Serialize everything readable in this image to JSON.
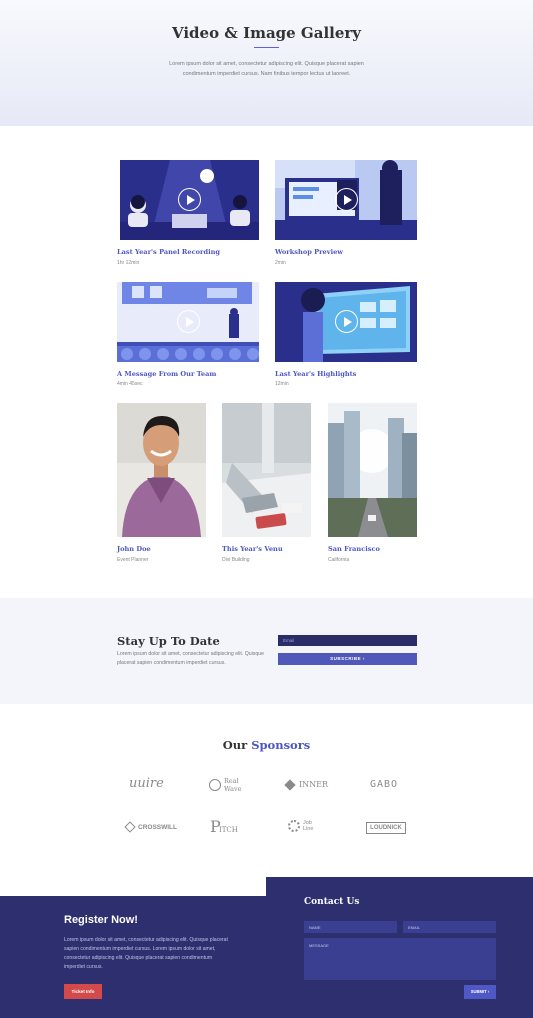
{
  "hero": {
    "title": "Video & Image Gallery",
    "text": "Lorem ipsum dolor sit amet, consectetur adipiscing elit. Quisque placerat sapien condimentum imperdiet cursus. Nam finibus tempor lectus ut laoreet."
  },
  "videos": [
    {
      "title": "Last Year's Panel Recording",
      "meta": "1hr 12min"
    },
    {
      "title": "Workshop Preview",
      "meta": "2min"
    },
    {
      "title": "A Message From Our Team",
      "meta": "4min 45sec"
    },
    {
      "title": "Last Year's Highlights",
      "meta": "12min"
    }
  ],
  "images": [
    {
      "title": "John Doe",
      "meta": "Event Planner"
    },
    {
      "title": "This Year's Venu",
      "meta": "Divi Building"
    },
    {
      "title": "San Francisco",
      "meta": "California"
    }
  ],
  "newsletter": {
    "title": "Stay Up To Date",
    "text": "Lorem ipsum dolor sit amet, consectetur adipiscing elit. Quisque placerat sapien condimentum imperdiet cursus.",
    "email_placeholder": "Email",
    "subscribe_label": "SUBSCRIBE ›"
  },
  "sponsors": {
    "title_plain": "Our ",
    "title_accent": "Sponsors",
    "logos": [
      "uuire",
      "Real Wave",
      "INNER",
      "GABO",
      "CROSSWILL",
      "ITCH",
      "Job Line",
      "LOUDNICK"
    ]
  },
  "register": {
    "title": "Register Now!",
    "text": "Lorem ipsum dolor sit amet, consectetur adipiscing elit. Quisque placerat sapien condimentum imperdiet cursus. Lorem ipsum dolor sit amet, consectetur adipiscing elit. Quisque placerat sapien condimentum imperdiet cursus.",
    "button": "Ticket Info"
  },
  "contact": {
    "title": "Contact Us",
    "name_placeholder": "NAME",
    "email_placeholder": "EMAIL",
    "message_placeholder": "MESSAGE",
    "submit": "SUBMIT ›"
  },
  "colors": {
    "accent": "#4d55c2",
    "navy": "#2d2f6e",
    "red": "#d44a4a"
  }
}
